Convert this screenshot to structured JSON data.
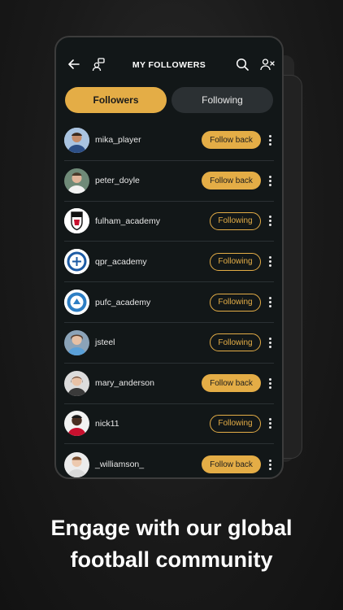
{
  "header": {
    "title": "MY FOLLOWERS",
    "back_icon": "arrow-left-icon",
    "switch_icon": "user-switch-icon",
    "search_icon": "search-icon",
    "remove_icon": "user-remove-icon"
  },
  "tabs": [
    {
      "label": "Followers",
      "active": true
    },
    {
      "label": "Following",
      "active": false
    }
  ],
  "followers": [
    {
      "username": "mika_player",
      "button": "Follow back",
      "state": "followback",
      "avatar": "person"
    },
    {
      "username": "peter_doyle",
      "button": "Follow back",
      "state": "followback",
      "avatar": "person"
    },
    {
      "username": "fulham_academy",
      "button": "Following",
      "state": "following",
      "avatar": "fulham-crest"
    },
    {
      "username": "qpr_academy",
      "button": "Following",
      "state": "following",
      "avatar": "qpr-crest"
    },
    {
      "username": "pufc_academy",
      "button": "Following",
      "state": "following",
      "avatar": "peterborough-crest"
    },
    {
      "username": "jsteel",
      "button": "Following",
      "state": "following",
      "avatar": "person"
    },
    {
      "username": "mary_anderson",
      "button": "Follow back",
      "state": "followback",
      "avatar": "person"
    },
    {
      "username": "nick11",
      "button": "Following",
      "state": "following",
      "avatar": "person"
    },
    {
      "username": "_williamson_",
      "button": "Follow back",
      "state": "followback",
      "avatar": "person"
    }
  ],
  "caption": {
    "line1": "Engage with our global",
    "line2": "football community"
  },
  "colors": {
    "accent": "#e4ad46",
    "screen_bg": "#121718",
    "inactive_tab": "#2b3033"
  }
}
